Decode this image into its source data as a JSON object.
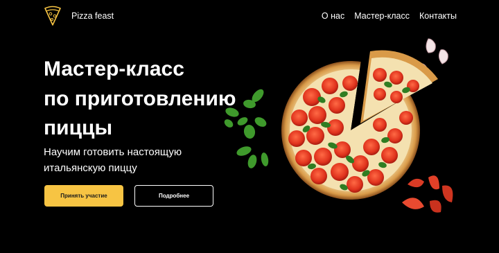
{
  "brand": {
    "name": "Pizza feast",
    "accent": "#f7c443"
  },
  "nav": {
    "items": [
      "О нас",
      "Мастер-класс",
      "Контакты"
    ]
  },
  "hero": {
    "title_lines": [
      "Мастер-класс",
      "по приготовлению",
      "пиццы"
    ],
    "subtitle_lines": [
      "Научим готовить настоящую",
      "итальянскую пиццу"
    ],
    "primary_button": "Принять участие",
    "secondary_button": "Подробнее"
  },
  "icons": {
    "logo": "pizza-slice-icon"
  }
}
